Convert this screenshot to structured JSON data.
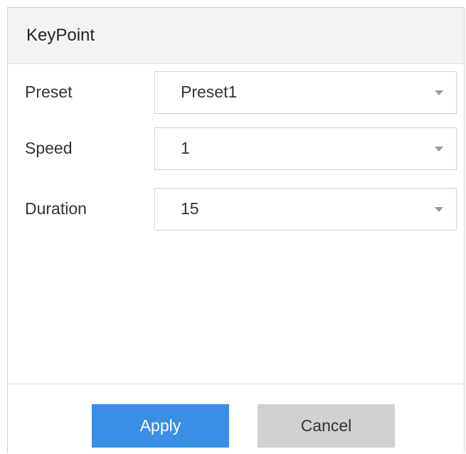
{
  "dialog": {
    "title": "KeyPoint"
  },
  "form": {
    "fields": [
      {
        "label": "Preset",
        "value": "Preset1"
      },
      {
        "label": "Speed",
        "value": "1"
      },
      {
        "label": "Duration",
        "value": "15"
      }
    ]
  },
  "footer": {
    "apply_label": "Apply",
    "cancel_label": "Cancel"
  },
  "colors": {
    "primary_button": "#3a8ee6",
    "secondary_button": "#d0d0d0",
    "header_background": "#f4f4f4"
  },
  "icons": {
    "dropdown": "chevron-down-icon"
  }
}
